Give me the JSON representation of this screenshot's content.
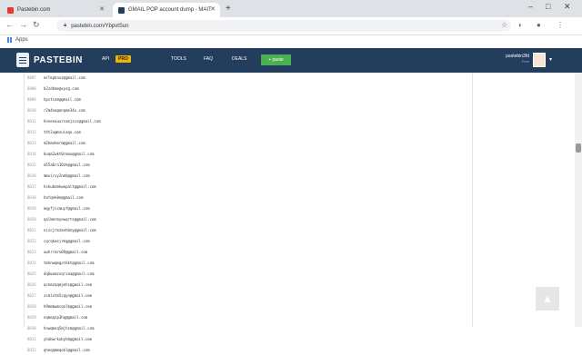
{
  "browser": {
    "tabs": [
      {
        "label": "Pastebin.com",
        "color": "#e53935"
      },
      {
        "label": "GMAIL POP account dump - MAIT",
        "color": "#233d5c"
      }
    ],
    "url": "pastebin.com/YbpvtSun",
    "bookmarks": [
      {
        "label": "Apps"
      }
    ]
  },
  "header": {
    "logo": "PASTEBIN",
    "nav": [
      "API",
      "TOOLS",
      "FAQ",
      "DEALS"
    ],
    "pro_badge": "PRO",
    "paste_button": "+ paste",
    "username": "pastebin3fd",
    "user_sub": "Free"
  },
  "code_lines": [
    {
      "num": "8007",
      "text": "mrlkpbnuz@gmail.com"
    },
    {
      "num": "8008",
      "text": "b2zdkme@xyzg.com"
    },
    {
      "num": "8009",
      "text": "hpstinm@gmail.com"
    },
    {
      "num": "8010",
      "text": "r2m4ea@anqme34x.com"
    },
    {
      "num": "8011",
      "text": "hnneeauurvxmjzss@gmail.com"
    },
    {
      "num": "8012",
      "text": "t4t2u@mzuiaqo.com"
    },
    {
      "num": "8013",
      "text": "m2kmehmrm@gmail.com"
    },
    {
      "num": "8014",
      "text": "buqm2wkt0rmax@gmail.com"
    },
    {
      "num": "8015",
      "text": "m55a6rn10zk@gmail.com"
    },
    {
      "num": "8016",
      "text": "mmuirxy2nmb@gmail.com"
    },
    {
      "num": "8017",
      "text": "hxkubnmkwepalt@gmail.com"
    },
    {
      "num": "8018",
      "text": "hafqek0e@gmail.com"
    },
    {
      "num": "8019",
      "text": "mqyfjscmuyf@gmail.com"
    },
    {
      "num": "8020",
      "text": "qalkmrmyowqrts@gmail.com"
    },
    {
      "num": "8021",
      "text": "nizcjrmzkehbny@gmail.com"
    },
    {
      "num": "8022",
      "text": "cqrqkaejrmg@gmail.com"
    },
    {
      "num": "8023",
      "text": "uwhrrmrn09@gmail.com"
    },
    {
      "num": "8024",
      "text": "tmhnwqmgxtbkt@gmail.com"
    },
    {
      "num": "8025",
      "text": "dq6wumzvqrzaa@gmail.com"
    },
    {
      "num": "8026",
      "text": "qckmzqqmjmhz@gmail.com"
    },
    {
      "num": "8027",
      "text": "zsmlxtm5cqyn@gmail.com"
    },
    {
      "num": "8028",
      "text": "h9mmbwmcqnlb@gmail.com"
    },
    {
      "num": "8029",
      "text": "nqmeqzp3hq@gmail.com"
    },
    {
      "num": "8030",
      "text": "hnwqmoq5mjhzm@gmail.com"
    },
    {
      "num": "8031",
      "text": "yhabwrkubyhb@gmail.com"
    },
    {
      "num": "8032",
      "text": "qheqqmmqebl@gmail.com"
    }
  ],
  "back_to_top": "▲"
}
